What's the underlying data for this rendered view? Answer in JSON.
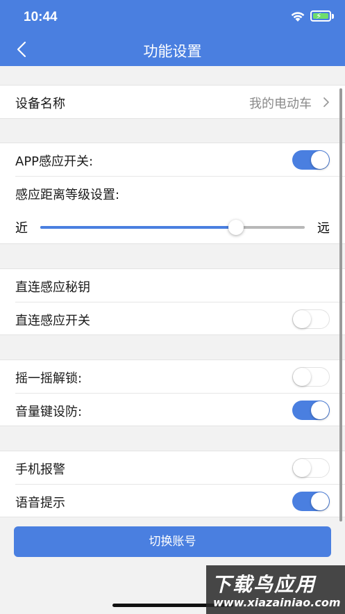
{
  "status_bar": {
    "time": "10:44"
  },
  "nav": {
    "title": "功能设置"
  },
  "device": {
    "label": "设备名称",
    "value": "我的电动车"
  },
  "sensing": {
    "app_switch_label": "APP感应开关:",
    "app_switch_on": true,
    "distance_label": "感应距离等级设置:",
    "near_label": "近",
    "far_label": "远",
    "distance_level": 0.74
  },
  "direct": {
    "key_label": "直连感应秘钥",
    "switch_label": "直连感应开关",
    "switch_on": false
  },
  "lock": {
    "shake_label": "摇一摇解锁:",
    "shake_on": false,
    "volume_label": "音量键设防:",
    "volume_on": true
  },
  "alerts": {
    "alarm_label": "手机报警",
    "alarm_on": false,
    "voice_label": "语音提示",
    "voice_on": true
  },
  "actions": {
    "switch_account": "切换账号"
  },
  "watermark": {
    "title": "下载鸟应用",
    "url": "www.xiazainiao.com"
  },
  "colors": {
    "accent": "#4a7fe0",
    "background": "#f2f2f2",
    "battery": "#6fde6a"
  }
}
